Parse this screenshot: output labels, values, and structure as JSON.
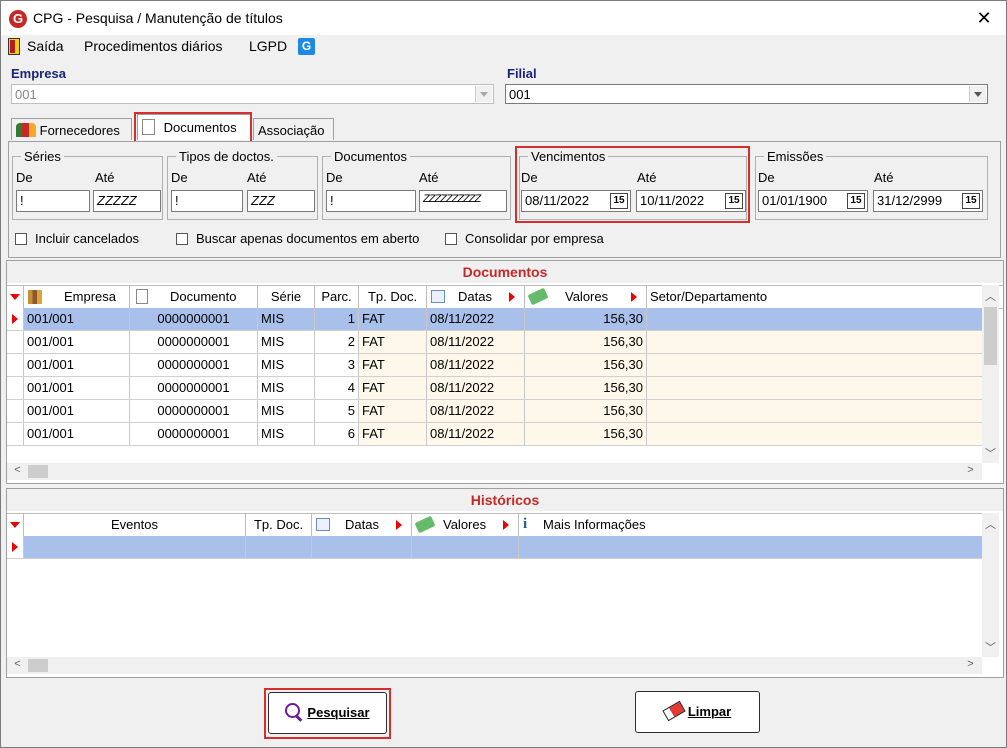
{
  "window": {
    "title": "CPG - Pesquisa / Manutenção de títulos",
    "app_icon": "G",
    "close_glyph": "✕"
  },
  "menu": {
    "items": [
      {
        "label": "Saída"
      },
      {
        "label": "Procedimentos diários"
      },
      {
        "label": "LGPD"
      }
    ],
    "extra_icon": "G"
  },
  "empresa": {
    "label": "Empresa",
    "value": "001"
  },
  "filial": {
    "label": "Filial",
    "value": "001"
  },
  "tabs": [
    {
      "label": "Fornecedores"
    },
    {
      "label": "Documentos"
    },
    {
      "label": "Associação"
    }
  ],
  "filters": {
    "series": {
      "legend": "Séries",
      "de_label": "De",
      "ate_label": "Até",
      "de": "!",
      "ate": "ZZZZZ"
    },
    "tipos": {
      "legend": "Tipos de doctos.",
      "de_label": "De",
      "ate_label": "Até",
      "de": "!",
      "ate": "ZZZ"
    },
    "documentos": {
      "legend": "Documentos",
      "de_label": "De",
      "ate_label": "Até",
      "de": "!",
      "ate": "ZZZZZZZZZZ"
    },
    "vencimentos": {
      "legend": "Vencimentos",
      "de_label": "De",
      "ate_label": "Até",
      "de": "08/11/2022",
      "ate": "10/11/2022"
    },
    "emissoes": {
      "legend": "Emissões",
      "de_label": "De",
      "ate_label": "Até",
      "de": "01/01/1900",
      "ate": "31/12/2999"
    },
    "calendar_glyph": "15"
  },
  "checkboxes": [
    {
      "label": "Incluir cancelados",
      "checked": false
    },
    {
      "label": "Buscar apenas documentos em aberto",
      "checked": false
    },
    {
      "label": "Consolidar por empresa",
      "checked": false
    }
  ],
  "documentos_grid": {
    "title": "Documentos",
    "columns": [
      "Empresa",
      "Documento",
      "Série",
      "Parc.",
      "Tp. Doc.",
      "Datas",
      "Valores",
      "Setor/Departamento"
    ],
    "rows": [
      [
        "001/001",
        "0000000001",
        "MIS",
        "1",
        "FAT",
        "08/11/2022",
        "156,30",
        ""
      ],
      [
        "001/001",
        "0000000001",
        "MIS",
        "2",
        "FAT",
        "08/11/2022",
        "156,30",
        ""
      ],
      [
        "001/001",
        "0000000001",
        "MIS",
        "3",
        "FAT",
        "08/11/2022",
        "156,30",
        ""
      ],
      [
        "001/001",
        "0000000001",
        "MIS",
        "4",
        "FAT",
        "08/11/2022",
        "156,30",
        ""
      ],
      [
        "001/001",
        "0000000001",
        "MIS",
        "5",
        "FAT",
        "08/11/2022",
        "156,30",
        ""
      ],
      [
        "001/001",
        "0000000001",
        "MIS",
        "6",
        "FAT",
        "08/11/2022",
        "156,30",
        ""
      ]
    ]
  },
  "historicos_grid": {
    "title": "Históricos",
    "columns": [
      "Eventos",
      "Tp. Doc.",
      "Datas",
      "Valores",
      "Mais Informações"
    ]
  },
  "buttons": {
    "pesquisar": "Pesquisar",
    "limpar": "Limpar"
  },
  "colors": {
    "accent_red": "#d32f2f",
    "selected_row": "#a8c0ea",
    "stripe": "#fdf8ea",
    "title_red": "#c62828"
  }
}
